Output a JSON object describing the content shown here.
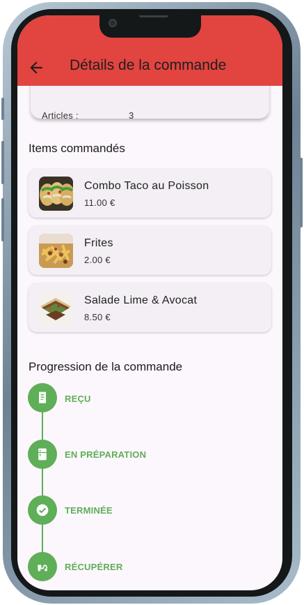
{
  "app_bar": {
    "title": "Détails de la commande",
    "back_icon": "arrow-left-icon",
    "color": "#e24440"
  },
  "summary": {
    "articles_label": "Articles :",
    "articles_value": "3"
  },
  "items_section": {
    "heading": "Items commandés",
    "items": [
      {
        "name": "Combo Taco au Poisson",
        "price": "11.00 €"
      },
      {
        "name": "Frites",
        "price": "2.00 €"
      },
      {
        "name": "Salade Lime & Avocat",
        "price": "8.50 €"
      }
    ]
  },
  "progress_section": {
    "heading": "Progression de la commande",
    "accent_color": "#5fae58",
    "steps": [
      {
        "label": "REÇU",
        "icon": "receipt-icon"
      },
      {
        "label": "EN PRÉPARATION",
        "icon": "kitchen-icon"
      },
      {
        "label": "TERMINÉE",
        "icon": "check-circle-icon"
      },
      {
        "label": "RÉCUPÉRER",
        "icon": "delivery-scooter-icon"
      }
    ]
  }
}
